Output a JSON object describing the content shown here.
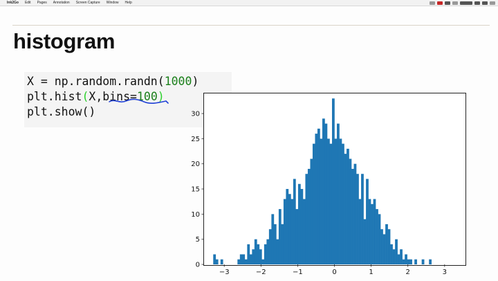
{
  "menubar": {
    "items": [
      "Ink2Go",
      "Edit",
      "Pages",
      "Annotation",
      "Screen Capture",
      "Window",
      "Help"
    ]
  },
  "slide": {
    "title": "histogram",
    "code": [
      {
        "parts": [
          {
            "t": "X = np.random.randn(",
            "c": "plain"
          },
          {
            "t": "1000",
            "c": "num"
          },
          {
            "t": ")",
            "c": "plain"
          }
        ]
      },
      {
        "parts": [
          {
            "t": "plt.hist",
            "c": "plain"
          },
          {
            "t": "(",
            "c": "hl"
          },
          {
            "t": "X,bins=",
            "c": "plain"
          },
          {
            "t": "100",
            "c": "num"
          },
          {
            "t": ")",
            "c": "hl"
          }
        ]
      },
      {
        "parts": [
          {
            "t": "plt.show()",
            "c": "plain"
          }
        ]
      }
    ]
  },
  "colors": {
    "bar": "#1f77b4",
    "number": "#1a7f1a",
    "annotation": "#1e3fd6"
  },
  "chart_data": {
    "type": "bar",
    "title": "",
    "xlabel": "",
    "ylabel": "",
    "xlim": [
      -3.55,
      3.55
    ],
    "ylim": [
      0,
      34
    ],
    "xticks": [
      -3,
      -2,
      -1,
      0,
      1,
      2,
      3
    ],
    "xtick_labels": [
      "−3",
      "−2",
      "−1",
      "0",
      "1",
      "2",
      "3"
    ],
    "yticks": [
      0,
      5,
      10,
      15,
      20,
      25,
      30
    ],
    "ytick_labels": [
      "0",
      "5",
      "10",
      "15",
      "20",
      "25",
      "30"
    ],
    "bin_start": -3.3,
    "bin_width": 0.066,
    "values": [
      2,
      1,
      0,
      1,
      0,
      0,
      0,
      0,
      0,
      0,
      1,
      2,
      2,
      1,
      4,
      2,
      3,
      5,
      4,
      3,
      1,
      4,
      5,
      7,
      10,
      8,
      5,
      11,
      8,
      13,
      15,
      14,
      13,
      17,
      11,
      16,
      15,
      13,
      18,
      19,
      21,
      24,
      26,
      27,
      25,
      29,
      28,
      25,
      24,
      33,
      25,
      28,
      25,
      24,
      22,
      23,
      21,
      19,
      20,
      18,
      13,
      18,
      9,
      17,
      13,
      12,
      13,
      11,
      10,
      7,
      6,
      8,
      7,
      4,
      3,
      5,
      2,
      3,
      1,
      2,
      1,
      1,
      0,
      1,
      0,
      0,
      1,
      0,
      0,
      1
    ]
  }
}
